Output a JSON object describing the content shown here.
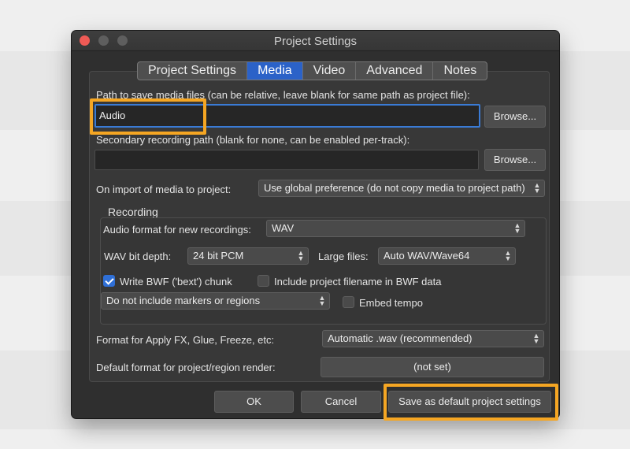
{
  "window": {
    "title": "Project Settings"
  },
  "tabs": [
    {
      "label": "Project Settings",
      "active": false
    },
    {
      "label": "Media",
      "active": true
    },
    {
      "label": "Video",
      "active": false
    },
    {
      "label": "Advanced",
      "active": false
    },
    {
      "label": "Notes",
      "active": false
    }
  ],
  "media_path": {
    "label": "Path to save media files (can be relative, leave blank for same path as project file):",
    "value": "Audio",
    "browse_label": "Browse..."
  },
  "secondary_path": {
    "label": "Secondary recording path (blank for none, can be enabled per-track):",
    "value": "",
    "browse_label": "Browse..."
  },
  "import": {
    "label": "On import of media to project:",
    "value": "Use global preference (do not copy media to project path)"
  },
  "recording": {
    "title": "Recording",
    "audio_format_label": "Audio format for new recordings:",
    "audio_format_value": "WAV",
    "bit_depth_label": "WAV bit depth:",
    "bit_depth_value": "24 bit PCM",
    "large_files_label": "Large files:",
    "large_files_value": "Auto WAV/Wave64",
    "bwf_label": "Write BWF ('bext') chunk",
    "bwf_checked": true,
    "include_filename_label": "Include project filename in BWF data",
    "include_filename_checked": false,
    "markers_value": "Do not include markers or regions",
    "embed_tempo_label": "Embed tempo",
    "embed_tempo_checked": false
  },
  "apply_fx": {
    "label": "Format for Apply FX, Glue, Freeze, etc:",
    "value": "Automatic .wav (recommended)"
  },
  "render": {
    "label": "Default format for project/region render:",
    "value": "(not set)"
  },
  "footer": {
    "ok_label": "OK",
    "cancel_label": "Cancel",
    "save_default_label": "Save as default project settings"
  },
  "colors": {
    "accent": "#2b62c8",
    "highlight": "#f5a623",
    "close": "#ee5a55"
  },
  "icons": {
    "updown": "chevron-up-down-icon",
    "check": "checkmark-icon"
  }
}
